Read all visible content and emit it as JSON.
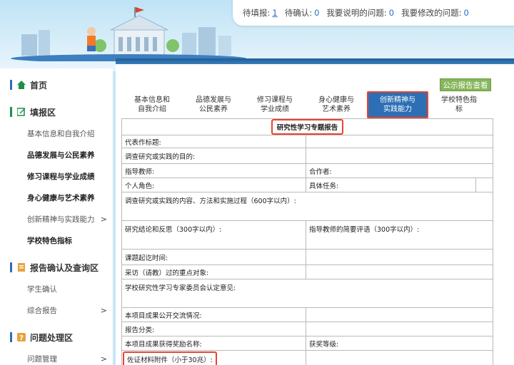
{
  "status": [
    {
      "label": "待填报:",
      "value": "1",
      "underline": true
    },
    {
      "label": "待确认:",
      "value": "0"
    },
    {
      "label": "我要说明的问题:",
      "value": "0"
    },
    {
      "label": "我要修改的问题:",
      "value": "0"
    }
  ],
  "sidebar": {
    "home": "首页",
    "fill_section": "填报区",
    "fill_items": [
      "基本信息和自我介绍",
      "品德发展与公民素养",
      "修习课程与学业成绩",
      "身心健康与艺术素养",
      "创新精神与实践能力",
      "学校特色指标"
    ],
    "confirm_section": "报告确认及查询区",
    "confirm_items": [
      "学生确认",
      "综合报告"
    ],
    "issue_section": "问题处理区",
    "issue_items": [
      "问题管理"
    ]
  },
  "main": {
    "public_report_button": "公示报告查看",
    "tabs": [
      [
        "基本信息和",
        "自我介绍"
      ],
      [
        "品德发展与",
        "公民素养"
      ],
      [
        "修习课程与",
        "学业成绩"
      ],
      [
        "身心健康与",
        "艺术素养"
      ],
      [
        "创新精神与",
        "实践能力"
      ],
      [
        "学校特色指",
        "标"
      ]
    ],
    "form": {
      "title": "研究性学习专题报告",
      "representative_title": "代表作标题:",
      "purpose": "调查研究或实践的目的:",
      "teacher": "指导教师:",
      "collaborator": "合作者:",
      "role": "个人角色:",
      "task": "具体任务:",
      "content": "调查研究或实践的内容、方法和实施过程（600字以内）:",
      "conclusion": "研究结论和反思（300字以内）:",
      "teacher_comment": "指导教师的简要评语（300字以内）:",
      "time": "课题起讫时间:",
      "interview": "采访（请教）过的重点对象:",
      "committee": "学校研究性学习专家委员会认定意见:",
      "exchange": "本项目成果公开交流情况:",
      "category": "报告分类:",
      "award": "本项目成果获得奖励名称:",
      "award_level": "获奖等级:",
      "attachment": "佐证材料附件（小于30兆）:"
    }
  }
}
